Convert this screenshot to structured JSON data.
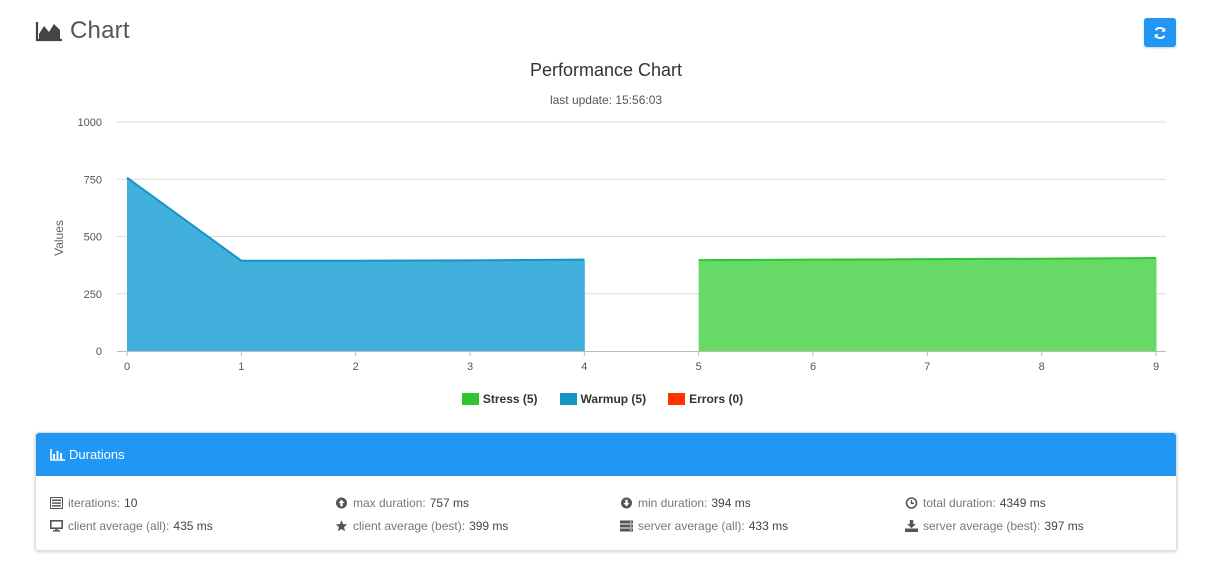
{
  "header": {
    "title": "Chart",
    "icon": "area-chart-icon"
  },
  "refresh_button": {
    "icon": "refresh-icon",
    "color": "#2196f3"
  },
  "chart_data": {
    "type": "area",
    "title": "Performance Chart",
    "subtitle": "last update: 15:56:03",
    "ylabel": "Values",
    "xlabel": "",
    "ylim": [
      0,
      1000
    ],
    "xlim": [
      0,
      9
    ],
    "yticks": [
      0,
      250,
      500,
      750,
      1000
    ],
    "xticks": [
      0,
      1,
      2,
      3,
      4,
      5,
      6,
      7,
      8,
      9
    ],
    "grid": true,
    "legend_position": "bottom",
    "series": [
      {
        "name": "Stress (5)",
        "color": "#2ec52e",
        "fill": "#66d966",
        "x": [
          5,
          6,
          7,
          8,
          9
        ],
        "y": [
          397,
          399,
          401,
          403,
          406
        ]
      },
      {
        "name": "Warmup (5)",
        "color": "#1694c6",
        "fill": "#41b0dc",
        "x": [
          0,
          1,
          2,
          3,
          4
        ],
        "y": [
          757,
          394,
          394,
          396,
          399
        ]
      },
      {
        "name": "Errors (0)",
        "color": "#ff3300",
        "fill": "#ff3300",
        "x": [],
        "y": []
      }
    ]
  },
  "durations": {
    "heading": "Durations",
    "heading_icon": "bar-chart-icon",
    "color": "#2196f3",
    "stats": [
      {
        "icon": "list-icon",
        "label": "iterations:",
        "value": "10"
      },
      {
        "icon": "arrow-up-circle-icon",
        "label": "max duration:",
        "value": "757 ms"
      },
      {
        "icon": "arrow-down-circle-icon",
        "label": "min duration:",
        "value": "394 ms"
      },
      {
        "icon": "clock-icon",
        "label": "total duration:",
        "value": "4349 ms"
      },
      {
        "icon": "monitor-icon",
        "label": "client average (all):",
        "value": "435 ms"
      },
      {
        "icon": "star-icon",
        "label": "client average (best):",
        "value": "399 ms"
      },
      {
        "icon": "server-icon",
        "label": "server average (all):",
        "value": "433 ms"
      },
      {
        "icon": "download-icon",
        "label": "server average (best):",
        "value": "397 ms"
      }
    ]
  }
}
